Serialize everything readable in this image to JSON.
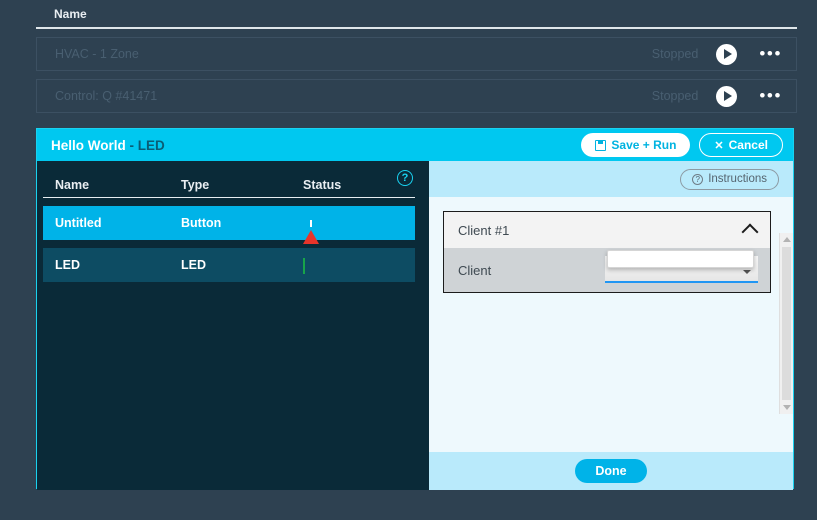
{
  "background": {
    "column_header": "Name",
    "rows": [
      {
        "name": "HVAC - 1 Zone",
        "status": "Stopped",
        "play_icon": "play-icon",
        "menu_icon": "more-options-icon"
      },
      {
        "name": "Control: Q #41471",
        "status": "Stopped",
        "play_icon": "play-icon",
        "menu_icon": "more-options-icon"
      }
    ]
  },
  "modal": {
    "title_main": "Hello World",
    "title_sub": " - LED",
    "save_label": "Save + Run",
    "save_icon": "save-icon",
    "cancel_label": "Cancel",
    "cancel_icon": "close-icon",
    "help_icon": "help-icon",
    "table": {
      "headers": [
        "Name",
        "Type",
        "Status"
      ],
      "rows": [
        {
          "name": "Untitled",
          "type": "Button",
          "status_icon": "warning-icon",
          "selected": true
        },
        {
          "name": "LED",
          "type": "LED",
          "status_icon": "check-icon",
          "selected": false
        }
      ]
    },
    "right": {
      "instructions_label": "Instructions",
      "instructions_icon": "help-icon",
      "accordion": {
        "title": "Client #1",
        "collapse_icon": "chevron-up-icon",
        "field_label": "Client",
        "field_value": "",
        "dropdown_icon": "chevron-down-icon"
      },
      "done_label": "Done",
      "scrollbar": {
        "up_icon": "scroll-up-icon",
        "down_icon": "scroll-down-icon"
      }
    }
  },
  "colors": {
    "app_bg": "#2e4151",
    "modal_bg": "#0a2a38",
    "accent_cyan": "#00c8f0",
    "selected_row": "#00b3e8",
    "row_plain": "#0d4c63",
    "warning_red": "#e8342a",
    "success_green": "#17a44a",
    "panel_light": "#eef9fd",
    "panel_bar": "#b9eafb"
  }
}
